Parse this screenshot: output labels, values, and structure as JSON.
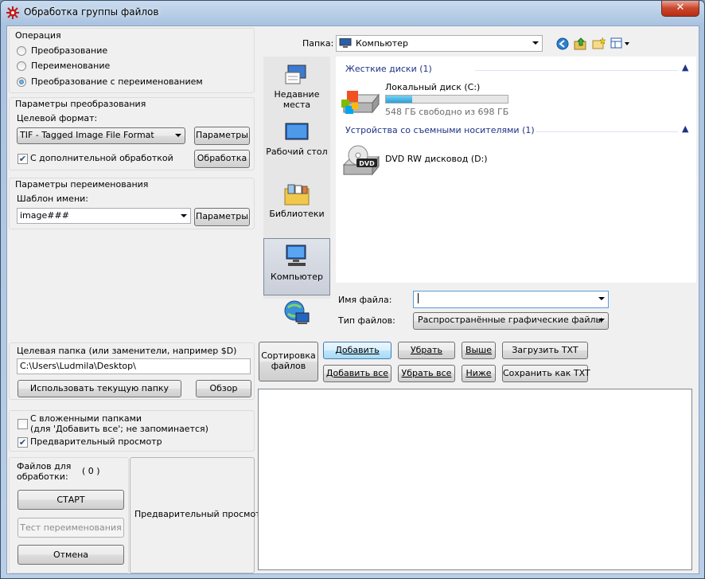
{
  "window": {
    "title": "Обработка группы файлов",
    "close": "✕"
  },
  "operation": {
    "group_title": "Операция",
    "options": [
      "Преобразование",
      "Переименование",
      "Преобразование с переименованием"
    ],
    "selected": 2
  },
  "convert": {
    "group_title": "Параметры преобразования",
    "format_label": "Целевой формат:",
    "format_value": "TIF - Tagged Image File Format",
    "params_button": "Параметры",
    "extra_checkbox": "С дополнительной обработкой",
    "extra_checked": true,
    "processing_button": "Обработка"
  },
  "rename": {
    "group_title": "Параметры переименования",
    "template_label": "Шаблон имени:",
    "template_value": "image###",
    "params_button": "Параметры"
  },
  "target": {
    "label": "Целевая папка (или заменители, например $D)",
    "path": "C:\\Users\\Ludmila\\Desktop\\",
    "use_current_button": "Использовать текущую папку",
    "browse_button": "Обзор"
  },
  "options": {
    "subfolders_line1": "С вложенными папками",
    "subfolders_line2": "(для 'Добавить все'; не запоминается)",
    "subfolders_checked": false,
    "preview_label": "Предварительный просмотр",
    "preview_checked": true
  },
  "counter": {
    "label": "Файлов для обработки:",
    "value": "( 0 )"
  },
  "actions": {
    "start": "СТАРТ",
    "test_rename": "Тест переименования",
    "cancel": "Отмена"
  },
  "preview_box": {
    "label": "Предварительный просмотр"
  },
  "browser": {
    "folder_label": "Папка:",
    "folder_value": "Компьютер",
    "nav": [
      {
        "label_line1": "Недавние",
        "label_line2": "места"
      },
      {
        "label_line1": "Рабочий стол",
        "label_line2": ""
      },
      {
        "label_line1": "Библиотеки",
        "label_line2": ""
      },
      {
        "label_line1": "Компьютер",
        "label_line2": ""
      }
    ],
    "nav_selected": 3,
    "sections": [
      {
        "title": "Жесткие диски (1)"
      },
      {
        "title": "Устройства со съемными носителями (1)"
      }
    ],
    "drive_c": {
      "name": "Локальный диск (C:)",
      "free": "548 ГБ свободно из 698 ГБ",
      "used_fraction": 0.215
    },
    "drive_d": {
      "name": "DVD RW дисковод (D:)",
      "badge": "DVD"
    },
    "filename_label": "Имя файла:",
    "filename_value": "",
    "filetype_label": "Тип файлов:",
    "filetype_value": "Распространённые графические файлы"
  },
  "list_buttons": {
    "sort": "Сортировка файлов",
    "add": "Добавить",
    "remove": "Убрать",
    "up": "Выше",
    "load_txt": "Загрузить TXT",
    "add_all": "Добавить все",
    "remove_all": "Убрать все",
    "down": "Ниже",
    "save_txt": "Сохранить как TXT"
  },
  "colors": {
    "accent": "#1e5b9c",
    "section_title": "#1e3287",
    "progress": "#26a0da"
  }
}
